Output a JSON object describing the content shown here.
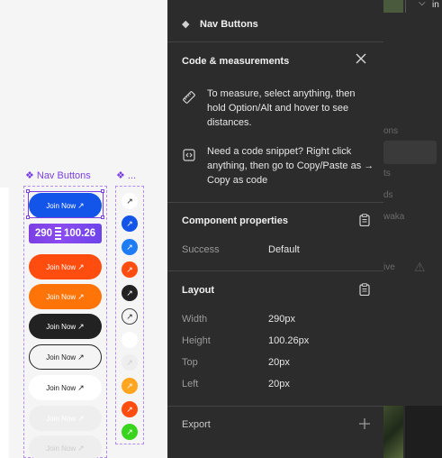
{
  "canvas": {
    "frame_labels": [
      "Nav Buttons",
      "..."
    ],
    "buttons": [
      {
        "label": "Join Now",
        "bg": "#1355e8",
        "fg": "#ffffff",
        "border": "none"
      },
      {
        "label": "Join Now",
        "bg": "#1f7cf7",
        "fg": "#ffffff",
        "border": "none"
      },
      {
        "label": "Join Now",
        "bg": "#ff4d0f",
        "fg": "#ffffff",
        "border": "none"
      },
      {
        "label": "Join Now",
        "bg": "#ff7408",
        "fg": "#ffffff",
        "border": "none"
      },
      {
        "label": "Join Now",
        "bg": "#222222",
        "fg": "#ffffff",
        "border": "none"
      },
      {
        "label": "Join Now",
        "bg": "#f4f4f4",
        "fg": "#222222",
        "border": "1px solid #222222"
      },
      {
        "label": "Join Now",
        "bg": "#ffffff",
        "fg": "#222222",
        "border": "none"
      },
      {
        "label": "Join Now",
        "bg": "#eeeeee",
        "fg": "#ffffff",
        "border": "none"
      },
      {
        "label": "Join Now",
        "bg": "#eeeeee",
        "fg": "#cccccc",
        "border": "none"
      }
    ],
    "button_arrow": "↗",
    "size_badge": {
      "width": "290",
      "height": "100.26"
    },
    "icon_buttons": [
      {
        "bg": "#ffffff",
        "fg": "#222222",
        "border": "none"
      },
      {
        "bg": "#1355e8",
        "fg": "#ffffff",
        "border": "none"
      },
      {
        "bg": "#1f7cf7",
        "fg": "#ffffff",
        "border": "none"
      },
      {
        "bg": "#ff4d0f",
        "fg": "#ffffff",
        "border": "none"
      },
      {
        "bg": "#222222",
        "fg": "#ffffff",
        "border": "none"
      },
      {
        "bg": "#f4f4f4",
        "fg": "#222222",
        "border": "1px solid #444444"
      },
      {
        "bg": "#ffffff",
        "fg": "#ffffff",
        "border": "none"
      },
      {
        "bg": "#eeeeee",
        "fg": "#cccccc",
        "border": "none"
      },
      {
        "bg": "#ffa51f",
        "fg": "#ffffff",
        "border": "none"
      },
      {
        "bg": "#ff4d0f",
        "fg": "#ffffff",
        "border": "none"
      },
      {
        "bg": "#39d51e",
        "fg": "#ffffff",
        "border": "none"
      }
    ]
  },
  "panel": {
    "component_name": "Nav Buttons",
    "code_section": {
      "title": "Code & measurements",
      "measure_text": "To measure, select anything, then hold Option/Alt and hover to see distances.",
      "snippet_text": "Need a code snippet? Right click anything, then go to Copy/Paste as → Copy as code"
    },
    "component_properties": {
      "title": "Component properties",
      "rows": [
        {
          "label": "Success",
          "value": "Default"
        }
      ]
    },
    "layout": {
      "title": "Layout",
      "rows": [
        {
          "label": "Width",
          "value": "290px"
        },
        {
          "label": "Height",
          "value": "100.26px"
        },
        {
          "label": "Top",
          "value": "20px"
        },
        {
          "label": "Left",
          "value": "20px"
        }
      ]
    },
    "export": {
      "title": "Export"
    }
  },
  "background_panel": {
    "tab_label": "in",
    "faded_items": [
      "ons",
      "ts",
      "ds",
      "waka",
      "ive"
    ]
  },
  "colors": {
    "accent": "#7b3fe4",
    "panel_bg": "#2c2c2c"
  },
  "icons": [
    "component-diamond-icon",
    "close-icon",
    "ruler-icon",
    "code-snippet-icon",
    "clipboard-icon",
    "plus-icon",
    "arrow-up-right-icon",
    "chevron-down-icon",
    "warning-icon"
  ]
}
